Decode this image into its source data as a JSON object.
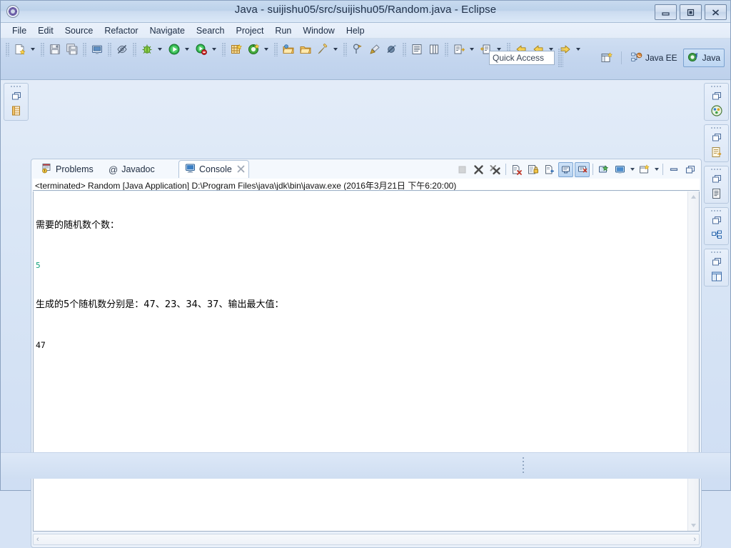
{
  "window": {
    "title": "Java - suijishu05/src/suijishu05/Random.java - Eclipse",
    "app_icon": "eclipse-icon",
    "controls": {
      "minimize": "Minimize",
      "maximize": "Maximize",
      "close": "Close"
    }
  },
  "menubar": {
    "items": [
      {
        "label": "File"
      },
      {
        "label": "Edit"
      },
      {
        "label": "Source"
      },
      {
        "label": "Refactor"
      },
      {
        "label": "Navigate"
      },
      {
        "label": "Search"
      },
      {
        "label": "Project"
      },
      {
        "label": "Run"
      },
      {
        "label": "Window"
      },
      {
        "label": "Help"
      }
    ]
  },
  "toolbar": {
    "groups": [
      {
        "icons": [
          "new-wizard-icon",
          "dropdown-arrow"
        ]
      },
      {
        "icons": [
          "save-icon",
          "save-all-icon"
        ]
      },
      {
        "icons": [
          "print-icon"
        ]
      },
      {
        "icons": [
          "toggle-mark-occurrences-icon"
        ]
      },
      {
        "icons": [
          "debug-icon",
          "dropdown-arrow",
          "run-icon",
          "dropdown-arrow",
          "run-coverage-icon",
          "dropdown-arrow"
        ]
      },
      {
        "icons": [
          "new-java-project-icon",
          "new-java-class-icon",
          "dropdown-arrow"
        ]
      },
      {
        "icons": [
          "open-type-icon",
          "open-task-icon",
          "search-icon",
          "dropdown-arrow"
        ]
      },
      {
        "icons": [
          "last-edit-location-icon",
          "pin-editor-icon",
          "skip-all-breakpoints-icon"
        ]
      },
      {
        "icons": [
          "toggle-block-selection-icon",
          "toggle-word-wrap-icon"
        ]
      },
      {
        "icons": [
          "next-annotation-icon",
          "dropdown-arrow",
          "previous-annotation-icon",
          "dropdown-arrow"
        ]
      },
      {
        "icons": [
          "back-icon",
          "forward-icon",
          "dropdown-arrow",
          "forward-history-icon",
          "dropdown-arrow"
        ]
      }
    ]
  },
  "quick_access": {
    "placeholder": "Quick Access",
    "value": "Quick Access"
  },
  "perspectives": {
    "open_perspective_icon": "open-perspective-icon",
    "items": [
      {
        "label": "Java EE",
        "icon": "java-ee-perspective-icon",
        "selected": false
      },
      {
        "label": "Java",
        "icon": "java-perspective-icon",
        "selected": true
      }
    ]
  },
  "left_trim": {
    "stacks": [
      {
        "restore_icon": "restore-icon",
        "view_icon": "package-explorer-icon",
        "view_name": "Package Explorer"
      }
    ]
  },
  "right_trim": {
    "stacks": [
      {
        "restore_icon": "restore-icon",
        "view_icon": "palette-icon",
        "view_name": "Palette"
      },
      {
        "restore_icon": "restore-icon",
        "view_icon": "properties-icon",
        "view_name": "Properties"
      },
      {
        "restore_icon": "restore-icon",
        "view_icon": "task-list-icon",
        "view_name": "Task List"
      },
      {
        "restore_icon": "restore-icon",
        "view_icon": "outline-icon",
        "view_name": "Outline"
      },
      {
        "restore_icon": "restore-icon",
        "view_icon": "templates-icon",
        "view_name": "Templates"
      }
    ]
  },
  "view_stack": {
    "tabs": [
      {
        "label": "Problems",
        "icon": "problems-icon",
        "active": false,
        "closable": false
      },
      {
        "label": "Javadoc",
        "icon": "javadoc-icon",
        "active": false,
        "closable": false
      },
      {
        "label": "Console",
        "icon": "console-icon",
        "active": true,
        "closable": true
      }
    ],
    "toolbar": [
      {
        "name": "terminate-button",
        "icon": "terminate-icon",
        "enabled": false,
        "toggled": false
      },
      {
        "name": "remove-launch-button",
        "icon": "remove-launch-icon",
        "enabled": true,
        "toggled": false
      },
      {
        "name": "remove-all-terminated-button",
        "icon": "remove-all-terminated-icon",
        "enabled": true,
        "toggled": false
      },
      {
        "name": "clear-console-button",
        "icon": "clear-console-icon",
        "enabled": true,
        "toggled": false
      },
      {
        "name": "scroll-lock-button",
        "icon": "scroll-lock-icon",
        "enabled": true,
        "toggled": false
      },
      {
        "name": "word-wrap-button",
        "icon": "word-wrap-icon",
        "enabled": true,
        "toggled": false
      },
      {
        "name": "show-console-on-output-button",
        "icon": "show-on-output-icon",
        "enabled": true,
        "toggled": true
      },
      {
        "name": "show-console-on-error-button",
        "icon": "show-on-error-icon",
        "enabled": true,
        "toggled": true
      },
      {
        "name": "pin-console-button",
        "icon": "pin-console-icon",
        "enabled": true,
        "toggled": false
      },
      {
        "name": "display-selected-console-button",
        "icon": "display-console-icon",
        "enabled": true,
        "toggled": false
      },
      {
        "name": "open-console-button",
        "icon": "open-console-icon",
        "enabled": true,
        "toggled": false
      },
      {
        "name": "minimize-view-button",
        "icon": "minimize-icon",
        "enabled": true,
        "toggled": false
      },
      {
        "name": "maximize-view-button",
        "icon": "maximize-icon",
        "enabled": true,
        "toggled": false
      }
    ]
  },
  "console": {
    "launch_line": "<terminated> Random [Java Application] D:\\Program Files\\java\\jdk\\bin\\javaw.exe (2016年3月21日 下午6:20:00)",
    "lines": [
      {
        "text": "需要的随机数个数：",
        "kind": "output"
      },
      {
        "text": "5",
        "kind": "input"
      },
      {
        "text": "生成的5个随机数分别是：47、23、34、37、输出最大值：",
        "kind": "output"
      },
      {
        "text": "47",
        "kind": "output"
      }
    ],
    "colors": {
      "output": "#000000",
      "input": "#11a07a",
      "background": "#ffffff"
    },
    "scrollbars": {
      "vertical_up": "▲",
      "vertical_down": "▼",
      "horizontal_left": "‹",
      "horizontal_right": "›"
    }
  },
  "statusbar": {
    "text": ""
  }
}
